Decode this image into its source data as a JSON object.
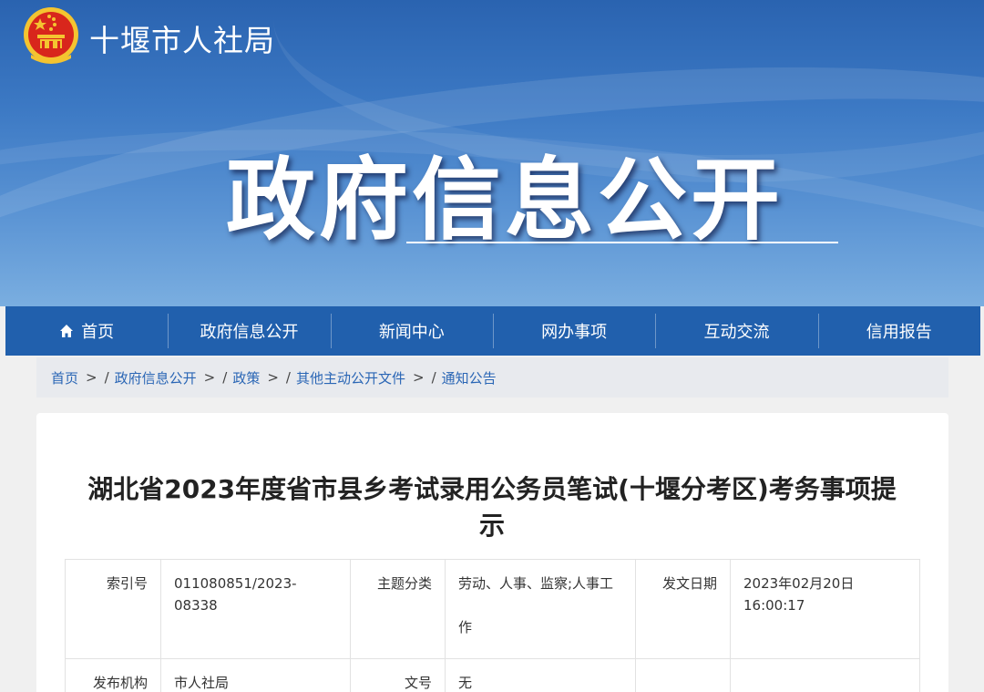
{
  "header": {
    "site_name": "十堰市人社局",
    "hero_title": "政府信息公开"
  },
  "nav": {
    "items": [
      {
        "label": "首页"
      },
      {
        "label": "政府信息公开"
      },
      {
        "label": "新闻中心"
      },
      {
        "label": "网办事项"
      },
      {
        "label": "互动交流"
      },
      {
        "label": "信用报告"
      }
    ]
  },
  "breadcrumb": {
    "items": [
      {
        "label": "首页"
      },
      {
        "label": "政府信息公开"
      },
      {
        "label": "政策"
      },
      {
        "label": "其他主动公开文件"
      },
      {
        "label": "通知公告"
      }
    ],
    "separator": ">",
    "slash": "/"
  },
  "article": {
    "title_line1": "湖北省2023年度省市县乡考试录用公务员笔试(十堰分考区)考务事项提",
    "title_line2": "示"
  },
  "meta": {
    "index_label": "索引号",
    "index_value": "011080851/2023-08338",
    "topic_label": "主题分类",
    "topic_value": "劳动、人事、监察;人事工作",
    "date_label": "发文日期",
    "date_value": "2023年02月20日 16:00:17",
    "org_label": "发布机构",
    "org_value": "市人社局",
    "doc_label": "文号",
    "doc_value": "无"
  },
  "colors": {
    "nav_bg": "#2160ad",
    "link": "#2a66b5",
    "emblem_red": "#d8261c",
    "emblem_gold": "#f4c430"
  }
}
